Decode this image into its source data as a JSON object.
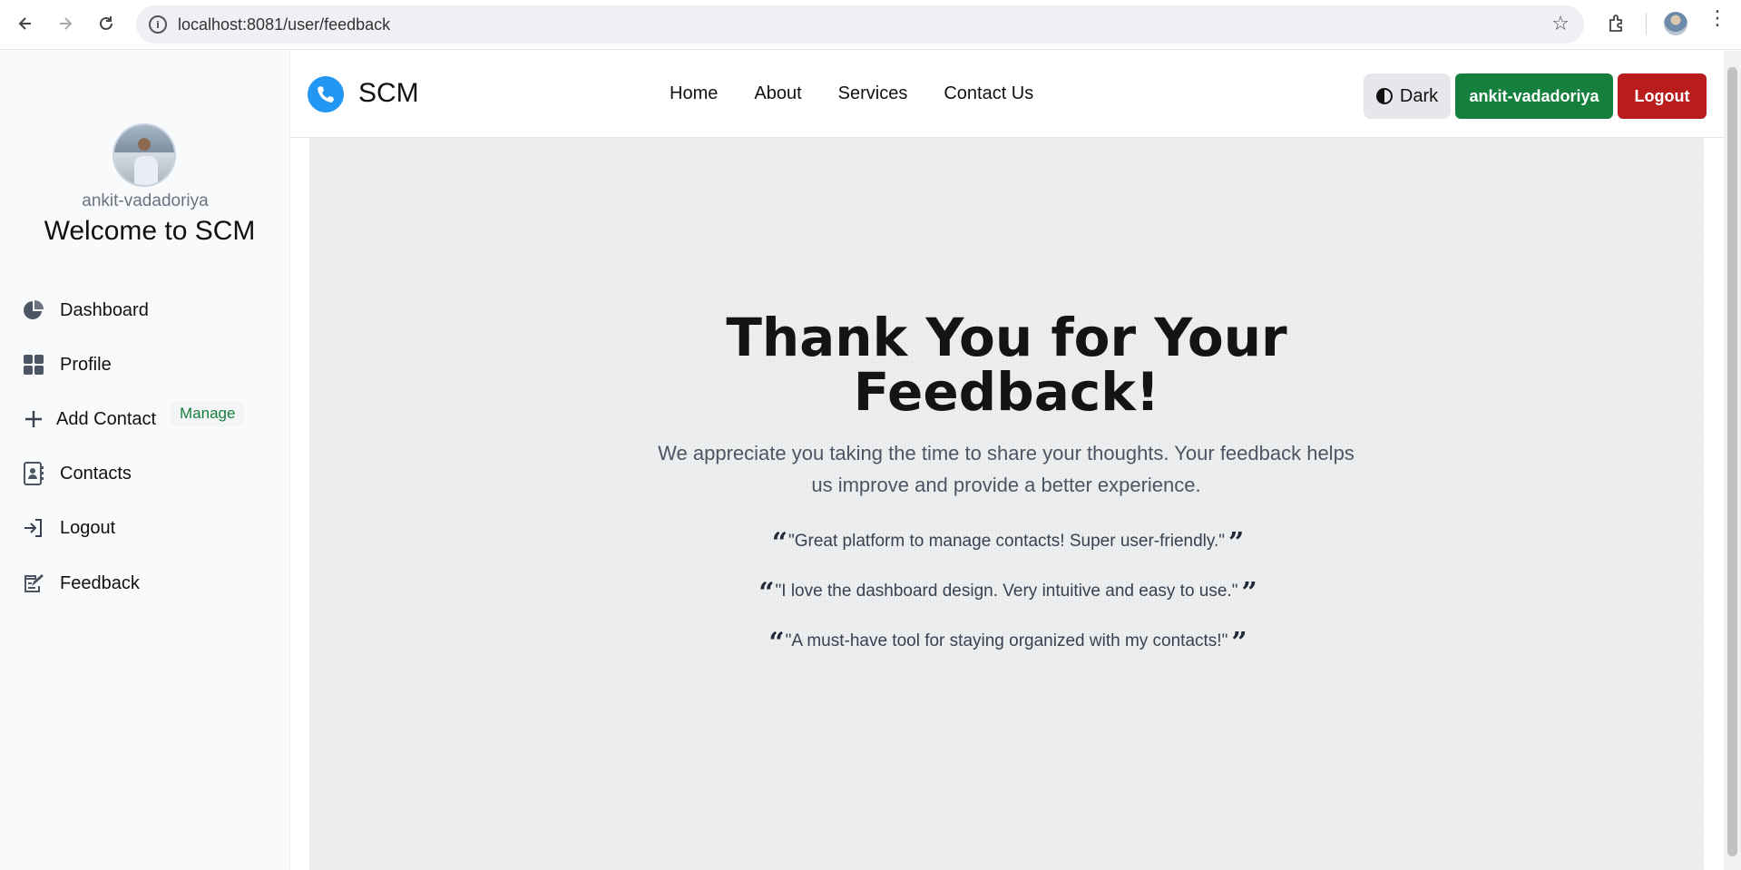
{
  "browser": {
    "url": "localhost:8081/user/feedback",
    "back_icon": "arrow-left-icon",
    "forward_icon": "arrow-right-icon",
    "reload_icon": "reload-icon"
  },
  "sidebar": {
    "username": "ankit-vadadoriya",
    "welcome": "Welcome to SCM",
    "items": [
      {
        "label": "Dashboard",
        "icon": "pie-chart-icon"
      },
      {
        "label": "Profile",
        "icon": "grid-icon",
        "badge": "Manage"
      },
      {
        "label": "Add Contact",
        "icon": "plus-icon"
      },
      {
        "label": "Contacts",
        "icon": "address-book-icon"
      },
      {
        "label": "Logout",
        "icon": "sign-out-icon"
      },
      {
        "label": "Feedback",
        "icon": "edit-note-icon"
      }
    ]
  },
  "navbar": {
    "brand": "SCM",
    "links": [
      "Home",
      "About",
      "Services",
      "Contact Us"
    ],
    "theme_button": "Dark",
    "user_button": "ankit-vadadoriya",
    "logout_button": "Logout"
  },
  "main": {
    "heading_line1": "Thank You for Your",
    "heading_line2": "Feedback!",
    "subtext_line1": "We appreciate you taking the time to share your thoughts. Your feedback helps",
    "subtext_line2": "us improve and provide a better experience.",
    "quotes": [
      "\"Great platform to manage contacts! Super user-friendly.\"",
      "\"I love the dashboard design. Very intuitive and easy to use.\"",
      "\"A must-have tool for staying organized with my contacts!\""
    ]
  },
  "colors": {
    "brand_blue": "#2196f3",
    "user_green": "#15803d",
    "logout_red": "#b91c1c"
  }
}
